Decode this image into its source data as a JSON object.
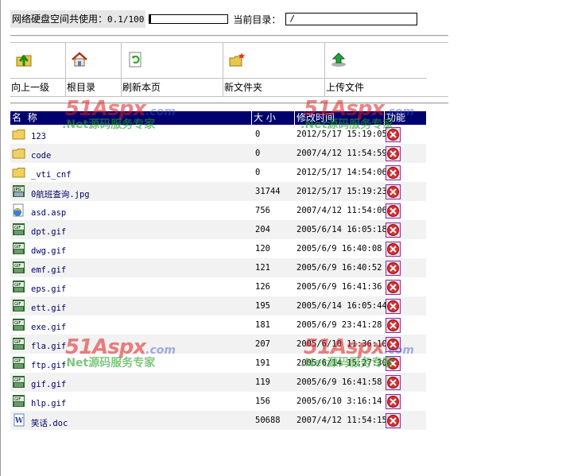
{
  "header": {
    "usage_label": "网络硬盘空间共使用：",
    "usage_value": "0.1/100",
    "usage_fraction": 0.001,
    "current_dir_label": "当前目录：",
    "current_dir_value": "/"
  },
  "toolbar": {
    "items": [
      {
        "label": "向上一级",
        "icon": "folder-up-icon"
      },
      {
        "label": "根目录",
        "icon": "home-icon"
      },
      {
        "label": "刷新本页",
        "icon": "refresh-icon"
      },
      {
        "label": "新文件夹",
        "icon": "new-folder-icon"
      },
      {
        "label": "上传文件",
        "icon": "upload-icon"
      }
    ]
  },
  "table": {
    "columns": [
      "名  称",
      "大 小",
      "修改时间",
      "功能"
    ],
    "rows": [
      {
        "name": "123",
        "size": "0",
        "modified": "2012/5/17 15:19:05",
        "type": "folder"
      },
      {
        "name": "code",
        "size": "0",
        "modified": "2007/4/12 11:54:59",
        "type": "folder"
      },
      {
        "name": "_vti_cnf",
        "size": "0",
        "modified": "2012/5/17 14:54:06",
        "type": "folder"
      },
      {
        "name": "0航班查询.jpg",
        "size": "31744",
        "modified": "2012/5/17 15:19:23",
        "type": "jpg"
      },
      {
        "name": "asd.asp",
        "size": "756",
        "modified": "2007/4/12 11:54:06",
        "type": "asp"
      },
      {
        "name": "dpt.gif",
        "size": "204",
        "modified": "2005/6/14 16:05:18",
        "type": "gif"
      },
      {
        "name": "dwg.gif",
        "size": "120",
        "modified": "2005/6/9 16:40:08",
        "type": "gif"
      },
      {
        "name": "emf.gif",
        "size": "121",
        "modified": "2005/6/9 16:40:52",
        "type": "gif"
      },
      {
        "name": "eps.gif",
        "size": "126",
        "modified": "2005/6/9 16:41:36",
        "type": "gif"
      },
      {
        "name": "ett.gif",
        "size": "195",
        "modified": "2005/6/14 16:05:44",
        "type": "gif"
      },
      {
        "name": "exe.gif",
        "size": "181",
        "modified": "2005/6/9 23:41:28",
        "type": "gif"
      },
      {
        "name": "fla.gif",
        "size": "207",
        "modified": "2005/6/10 11:36:10",
        "type": "gif"
      },
      {
        "name": "ftp.gif",
        "size": "191",
        "modified": "2005/6/14 15:27:30",
        "type": "gif"
      },
      {
        "name": "gif.gif",
        "size": "119",
        "modified": "2005/6/9 16:41:58",
        "type": "gif"
      },
      {
        "name": "hlp.gif",
        "size": "156",
        "modified": "2005/6/10 3:16:14",
        "type": "gif"
      },
      {
        "name": "笑话.doc",
        "size": "50688",
        "modified": "2007/4/12 11:54:15",
        "type": "doc"
      }
    ]
  },
  "watermark": {
    "brand": "51Aspx",
    "domain": ".com",
    "slogan": ".Net源码服务专家"
  },
  "colors": {
    "header_bg": "#00006e",
    "link": "#000066",
    "delete_icon": "#cc2222"
  }
}
